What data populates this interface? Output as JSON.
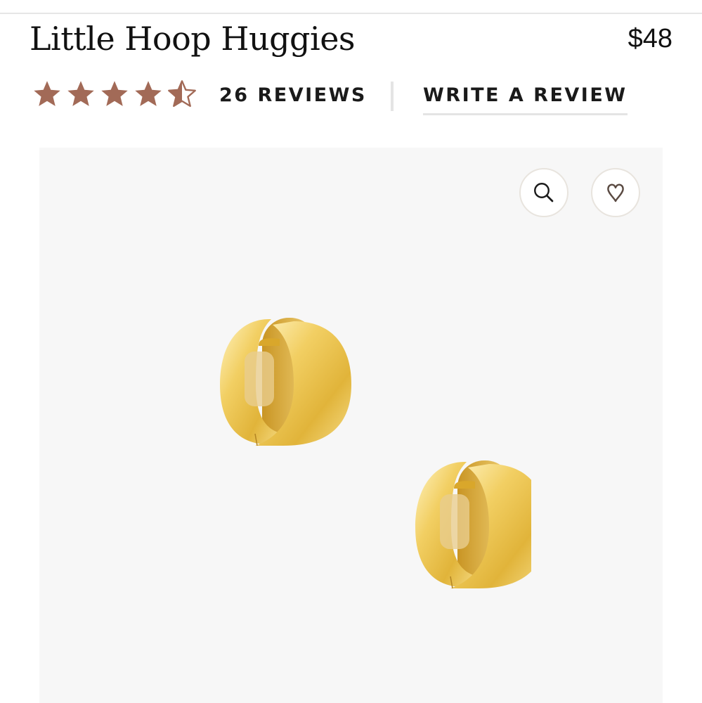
{
  "product": {
    "title": "Little Hoop Huggies",
    "price": "$48"
  },
  "rating": {
    "value": 4.5,
    "max": 5,
    "star_color": "#a26a57",
    "reviews_label": "26 REVIEWS",
    "write_review_label": "WRITE A REVIEW"
  },
  "gallery": {
    "background": "#f7f7f7",
    "zoom_icon": "search-icon",
    "favorite_icon": "heart-icon",
    "image_alt": "Gold chunky hoop huggie earrings"
  }
}
